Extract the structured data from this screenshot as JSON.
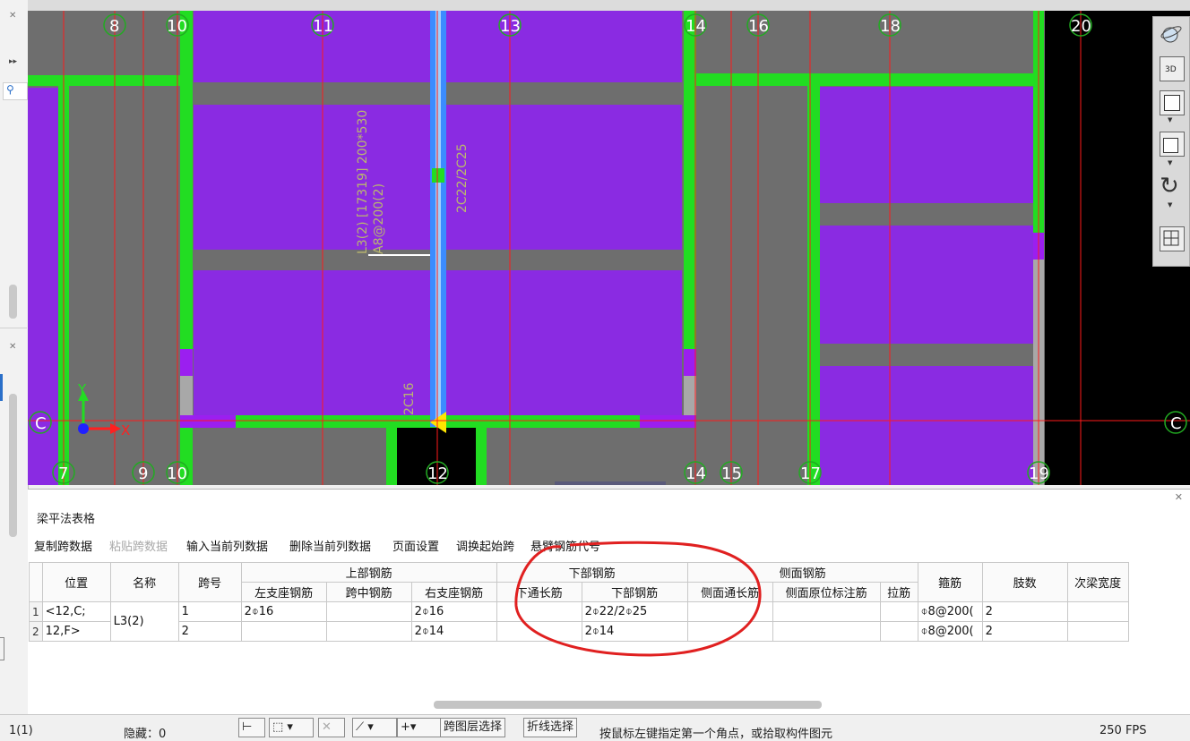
{
  "colors": {
    "slab": "#8a2be2",
    "beam_green": "#22dd22",
    "grid_line": "#ff1a1a",
    "annotation": "#b9b76f",
    "highlight_beam": "#3b8cff",
    "circle_ann": "#e02020"
  },
  "cad": {
    "top_axes": [
      "8",
      "10",
      "11",
      "13",
      "14",
      "16",
      "18",
      "20"
    ],
    "bottom_axes": [
      "7",
      "9",
      "10",
      "12",
      "14",
      "15",
      "17",
      "19"
    ],
    "row_axis_left": "C",
    "row_axis_right": "C",
    "beam_label_1": "L3(2) [17319] 200*530",
    "beam_label_2": "A8@200(2)",
    "beam_label_3": "2C22/2C25",
    "beam_label_4": "2C16",
    "ucs_x": "X",
    "ucs_y": "Y"
  },
  "viewbar": {
    "icons": [
      "orbit-icon",
      "view-3d-icon",
      "view-top-icon",
      "view-box-icon",
      "rotate-icon",
      "grid-layout-icon"
    ],
    "label_3d": "3D"
  },
  "panel": {
    "title": "梁平法表格",
    "toolbar": [
      {
        "label": "复制跨数据",
        "enabled": true
      },
      {
        "label": "粘贴跨数据",
        "enabled": false
      },
      {
        "label": "输入当前列数据",
        "enabled": true
      },
      {
        "label": "删除当前列数据",
        "enabled": true
      },
      {
        "label": "页面设置",
        "enabled": true
      },
      {
        "label": "调换起始跨",
        "enabled": true
      },
      {
        "label": "悬臂钢筋代号",
        "enabled": true
      }
    ],
    "headers": {
      "position": "位置",
      "name": "名称",
      "span": "跨号",
      "top_rebar": "上部钢筋",
      "left_support": "左支座钢筋",
      "mid_span": "跨中钢筋",
      "right_support": "右支座钢筋",
      "bottom_rebar": "下部钢筋",
      "bottom_through": "下通长筋",
      "bottom_bar": "下部钢筋",
      "side_rebar": "侧面钢筋",
      "side_through": "侧面通长筋",
      "side_in_situ": "侧面原位标注筋",
      "tie_bar": "拉筋",
      "stirrup": "箍筋",
      "legs": "肢数",
      "secondary_width": "次梁宽度"
    },
    "rows": [
      {
        "index": "1",
        "position": "<12,C;",
        "name": "L3(2)",
        "span": "1",
        "left_support": "2⌽16",
        "mid_span": "",
        "right_support": "2⌽16",
        "bottom_through": "",
        "bottom_bar": "2⌽22/2⌽25",
        "side_through": "",
        "side_in_situ": "",
        "tie_bar": "",
        "stirrup": "⌽8@200(",
        "legs": "2",
        "secondary_width": ""
      },
      {
        "index": "2",
        "position": "12,F>",
        "name": "",
        "span": "2",
        "left_support": "",
        "mid_span": "",
        "right_support": "2⌽14",
        "bottom_through": "",
        "bottom_bar": "2⌽14",
        "side_through": "",
        "side_in_situ": "",
        "tie_bar": "",
        "stirrup": "⌽8@200(",
        "legs": "2",
        "secondary_width": ""
      }
    ]
  },
  "status": {
    "floor": "1(1)",
    "hidden": "隐藏：0",
    "cross_layer": "跨图层选择",
    "polyline": "折线选择",
    "hint": "按鼠标左键指定第一个角点，或拾取构件图元",
    "fps": "250 FPS"
  }
}
